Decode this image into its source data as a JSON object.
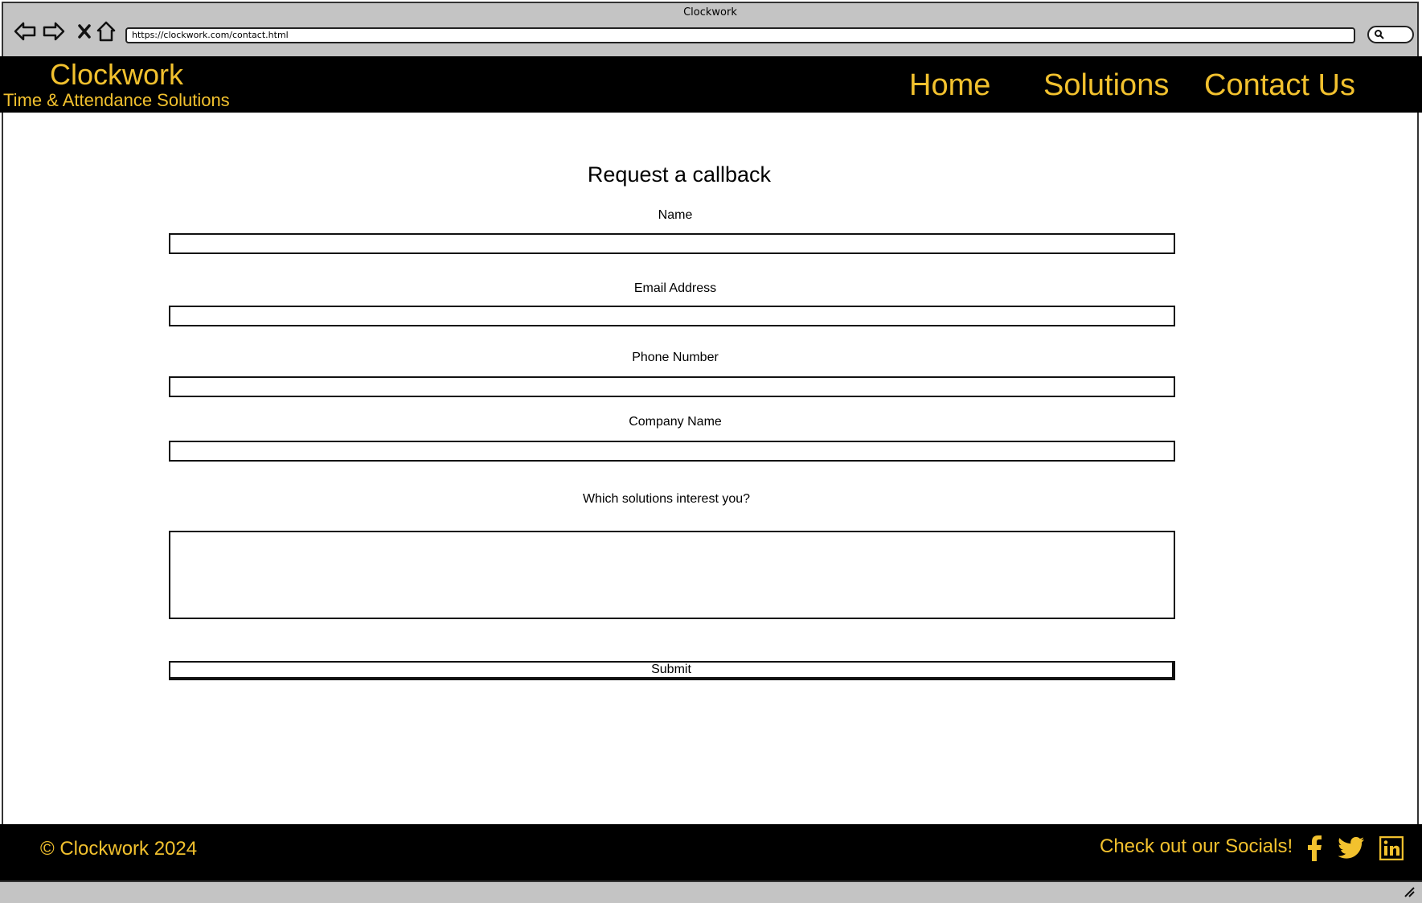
{
  "window": {
    "title": "Clockwork"
  },
  "browser": {
    "url": "https://clockwork.com/contact.html"
  },
  "header": {
    "brand": "Clockwork",
    "tagline": "Time & Attendance Solutions",
    "nav": [
      {
        "label": "Home"
      },
      {
        "label": "Solutions"
      },
      {
        "label": "Contact Us"
      }
    ]
  },
  "form": {
    "title": "Request a callback",
    "fields": [
      {
        "label": "Name",
        "value": ""
      },
      {
        "label": "Email Address",
        "value": ""
      },
      {
        "label": "Phone Number",
        "value": ""
      },
      {
        "label": "Company Name",
        "value": ""
      }
    ],
    "interest_label": "Which solutions interest you?",
    "interest_value": "",
    "submit_label": "Submit"
  },
  "footer": {
    "copyright": "© Clockwork 2024",
    "socials_label": "Check out our Socials!",
    "socials": [
      "facebook-icon",
      "twitter-icon",
      "linkedin-icon"
    ]
  },
  "colors": {
    "accent": "#f2c12e",
    "bar": "#000000",
    "chrome": "#c4c4c4"
  }
}
